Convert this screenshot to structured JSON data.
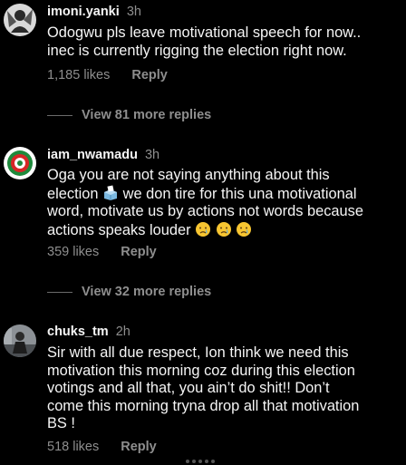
{
  "comments": [
    {
      "username": "imoni.yanki",
      "time": "3h",
      "lines": [
        "Odogwu pls leave motivational speech for now..",
        "inec is currently rigging the election right now."
      ],
      "likes": "1,185 likes",
      "reply_label": "Reply",
      "view_replies": "View 81 more replies",
      "avatar_icon": "avatar-person-icon"
    },
    {
      "username": "iam_nwamadu",
      "time": "3h",
      "lines": [
        "Oga you are not saying anything about this",
        "election",
        "we don tire for this una motivational",
        "word, motivate us by actions not words because",
        "actions speaks louder"
      ],
      "likes": "359 likes",
      "reply_label": "Reply",
      "view_replies": "View 32 more replies",
      "avatar_icon": "avatar-party-logo-icon",
      "inline_emoji": [
        "ballot-box-icon",
        "crying-face-icon",
        "crying-face-icon",
        "crying-face-icon"
      ]
    },
    {
      "username": "chuks_tm",
      "time": "2h",
      "lines": [
        "Sir with all due respect, Ion think we need this",
        "motivation this morning coz during this election",
        "votings and all that, you ain’t do shit!! Don’t",
        "come this morning tryna drop all that motivation",
        "BS !"
      ],
      "likes": "518 likes",
      "reply_label": "Reply",
      "avatar_icon": "avatar-photo-icon"
    }
  ],
  "colors": {
    "background": "#000000",
    "text": "#f5f5f5",
    "muted": "#8e8e8e"
  }
}
